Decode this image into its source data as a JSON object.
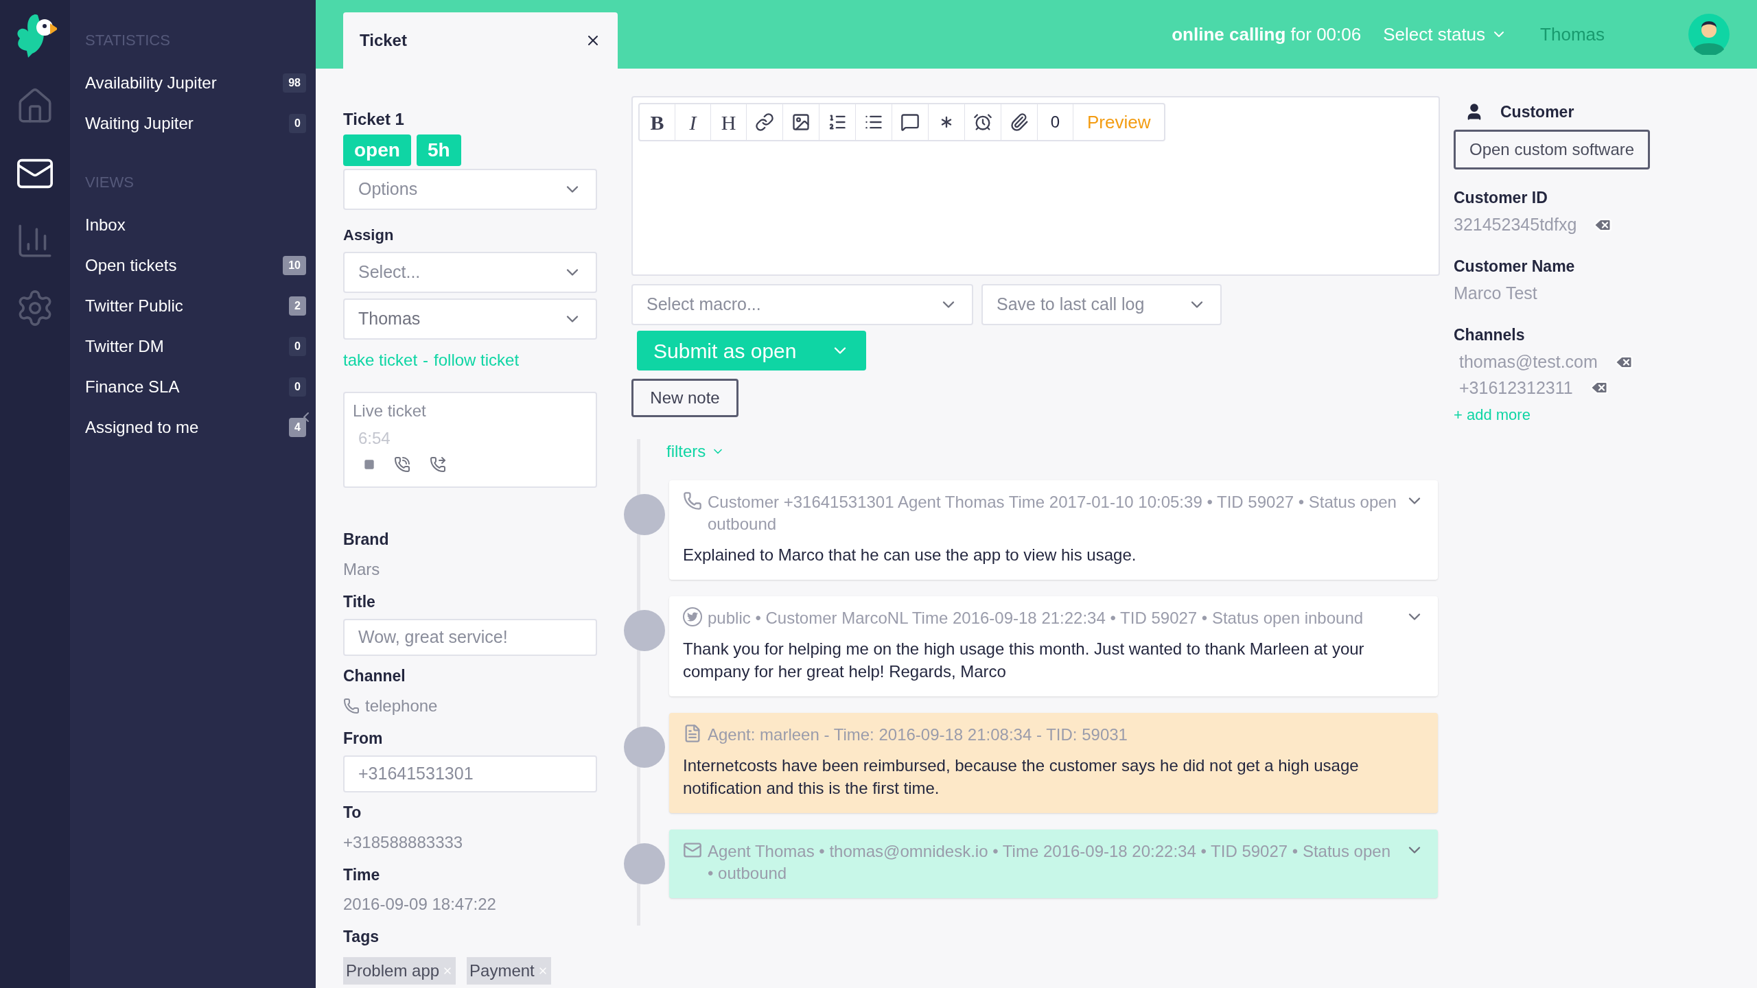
{
  "sidebar": {
    "nav_icons": [
      {
        "kind": "home",
        "selected": false
      },
      {
        "kind": "mail",
        "selected": true
      },
      {
        "kind": "chart",
        "selected": false
      },
      {
        "kind": "settings",
        "selected": false
      }
    ],
    "sections": [
      {
        "title": "STATISTICS",
        "items": [
          {
            "label": "Availability Jupiter",
            "count": "98",
            "muted": true
          },
          {
            "label": "Waiting Jupiter",
            "count": "0",
            "muted": true
          }
        ]
      },
      {
        "title": "VIEWS",
        "items": [
          {
            "label": "Inbox"
          },
          {
            "label": "Open tickets",
            "count": "10",
            "muted": false
          },
          {
            "label": "Twitter Public",
            "count": "2",
            "muted": false
          },
          {
            "label": "Twitter DM",
            "count": "0",
            "muted": true
          },
          {
            "label": "Finance SLA",
            "count": "0",
            "muted": true
          },
          {
            "label": "Assigned to me",
            "count": "4",
            "muted": false
          }
        ]
      }
    ]
  },
  "topbar": {
    "tab": {
      "label": "Ticket"
    },
    "call_status": "**online calling** for 00:06",
    "status_select": "Select status",
    "user": "Thomas"
  },
  "ticket": {
    "title": "Ticket 1",
    "badges": [
      "open",
      "5h"
    ],
    "options": {
      "placeholder": "Options"
    },
    "assign_label": "Assign",
    "assign_selects": [
      {
        "placeholder": "Select..."
      },
      {
        "value": "Thomas"
      }
    ],
    "links": [
      "take ticket",
      "follow ticket"
    ],
    "link_separator": "-",
    "live": {
      "label": "Live ticket",
      "timer": "6:54"
    },
    "fields": [
      {
        "kind": "text",
        "label": "Brand",
        "value": "Mars"
      },
      {
        "kind": "input",
        "label": "Title",
        "value": "Wow, great service!"
      },
      {
        "kind": "phone",
        "label": "Channel",
        "value": "telephone"
      },
      {
        "kind": "input",
        "label": "From",
        "value": "+31641531301"
      },
      {
        "kind": "text",
        "label": "To",
        "value": "+318588883333"
      },
      {
        "kind": "text",
        "label": "Time",
        "value": "2016-09-09 18:47:22"
      }
    ],
    "tags_label": "Tags",
    "tags": [
      "Problem app",
      "Payment"
    ]
  },
  "editor": {
    "toolbar": [
      {
        "kind": "bold",
        "label": "B"
      },
      {
        "kind": "italic",
        "label": "I"
      },
      {
        "kind": "heading",
        "label": "H"
      },
      {
        "kind": "link"
      },
      {
        "kind": "image"
      },
      {
        "kind": "ordered-list"
      },
      {
        "kind": "list"
      },
      {
        "kind": "comment"
      },
      {
        "kind": "asterisk"
      },
      {
        "kind": "alarm"
      },
      {
        "kind": "attach"
      },
      {
        "kind": "count",
        "label": "0"
      },
      {
        "kind": "preview",
        "label": "Preview"
      }
    ],
    "macro": {
      "placeholder": "Select macro..."
    },
    "save_select": {
      "placeholder": "Save to last call log"
    },
    "submit": "Submit as open",
    "new_note": "New note",
    "filters": "filters"
  },
  "timeline": [
    {
      "kind": "phone",
      "meta": "Customer +31641531301 Agent Thomas Time 2017-01-10 10:05:39 • TID 59027 • Status open outbound",
      "body": "Explained to Marco that he can use the app to view his usage."
    },
    {
      "kind": "twitter",
      "meta": "public • Customer MarcoNL Time 2016-09-18 21:22:34 • TID 59027 • Status open inbound",
      "body": "Thank you for helping me on the high usage this month. Just wanted to thank Marleen at your company for her great help! Regards, Marco"
    },
    {
      "kind": "note",
      "meta": "Agent: marleen - Time: 2016-09-18 21:08:34 - TID: 59031",
      "body": "Internetcosts have been reimbursed, because the customer says he did not get a high usage notification and this is the first time."
    },
    {
      "kind": "email",
      "meta": "Agent Thomas • thomas@omnidesk.io • Time 2016-09-18 20:22:34 • TID 59027 • Status open • outbound"
    }
  ],
  "customer": {
    "heading": "Customer",
    "button": "Open custom software",
    "fields": [
      {
        "label": "Customer ID",
        "values": [
          {
            "text": "321452345tdfxg",
            "removable": true
          }
        ]
      },
      {
        "label": "Customer Name",
        "values": [
          {
            "text": "Marco Test",
            "removable": false
          }
        ]
      },
      {
        "label": "Channels",
        "values": [
          {
            "text": "thomas@test.com",
            "removable": true
          },
          {
            "text": "+31612312311",
            "removable": true
          }
        ]
      }
    ],
    "add_more": "+ add more"
  }
}
